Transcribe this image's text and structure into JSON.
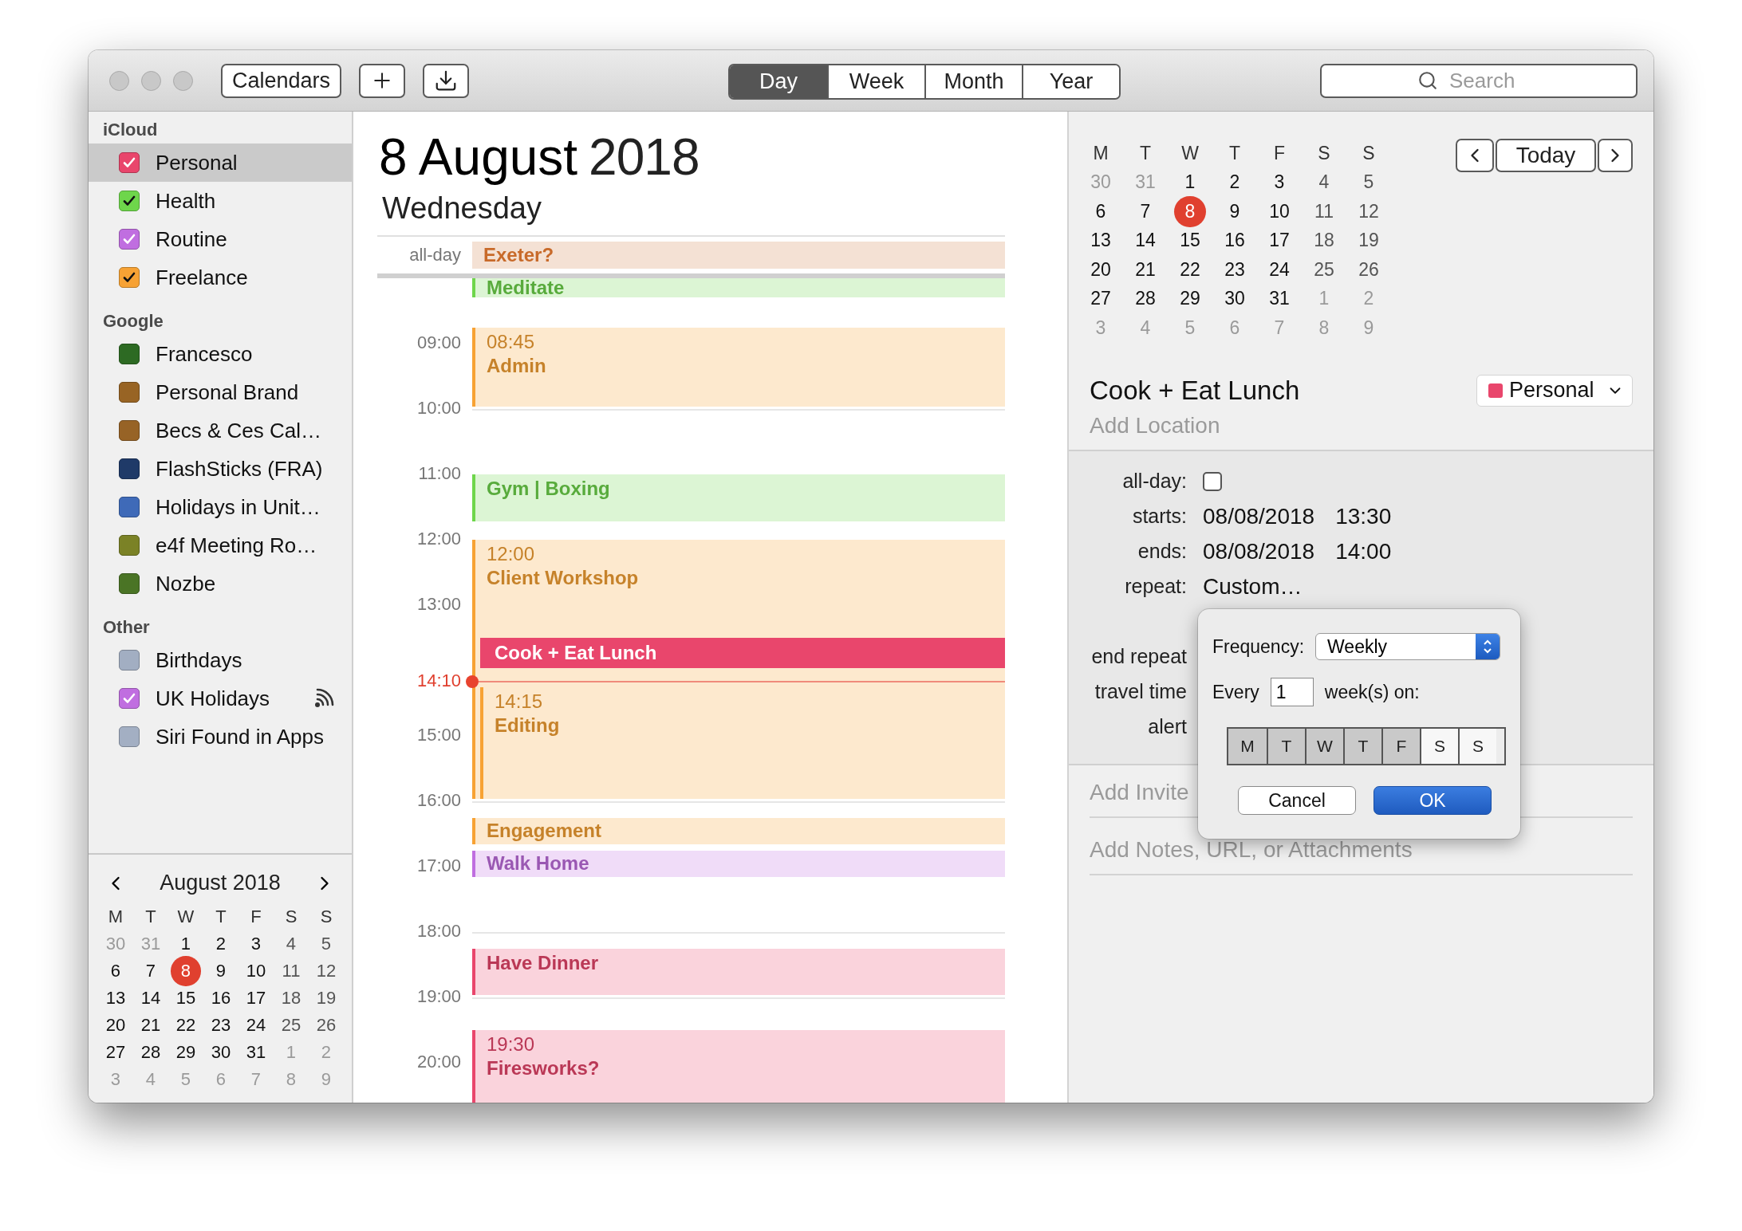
{
  "toolbar": {
    "calendars_button": "Calendars",
    "views": [
      {
        "label": "Day",
        "selected": true
      },
      {
        "label": "Week",
        "selected": false
      },
      {
        "label": "Month",
        "selected": false
      },
      {
        "label": "Year",
        "selected": false
      }
    ],
    "search": {
      "placeholder": "Search"
    }
  },
  "sidebar": {
    "groups": [
      {
        "title": "iCloud",
        "calendars": [
          {
            "name": "Personal",
            "color": "#e9466c",
            "checked": true,
            "selected": true,
            "subscribed": false
          },
          {
            "name": "Health",
            "color": "#6ed64b",
            "checked": true,
            "selected": false,
            "subscribed": false
          },
          {
            "name": "Routine",
            "color": "#c06ee0",
            "checked": true,
            "selected": false,
            "subscribed": false
          },
          {
            "name": "Freelance",
            "color": "#f7a234",
            "checked": true,
            "selected": false,
            "subscribed": false
          }
        ]
      },
      {
        "title": "Google",
        "calendars": [
          {
            "name": "Francesco",
            "color": "#2d6a23",
            "checked": false,
            "selected": false,
            "subscribed": false
          },
          {
            "name": "Personal Brand",
            "color": "#986424",
            "checked": false,
            "selected": false,
            "subscribed": false
          },
          {
            "name": "Becs & Ces Cal…",
            "color": "#976326",
            "checked": false,
            "selected": false,
            "subscribed": false
          },
          {
            "name": "FlashSticks (FRA)",
            "color": "#1f3a68",
            "checked": false,
            "selected": false,
            "subscribed": false
          },
          {
            "name": "Holidays in Unit…",
            "color": "#3f6ab8",
            "checked": false,
            "selected": false,
            "subscribed": false
          },
          {
            "name": "e4f Meeting Ro…",
            "color": "#7b8226",
            "checked": false,
            "selected": false,
            "subscribed": false
          },
          {
            "name": "Nozbe",
            "color": "#4a7425",
            "checked": false,
            "selected": false,
            "subscribed": false
          }
        ]
      },
      {
        "title": "Other",
        "calendars": [
          {
            "name": "Birthdays",
            "color": "#a2aec2",
            "checked": false,
            "selected": false,
            "subscribed": false
          },
          {
            "name": "UK Holidays",
            "color": "#c06ee0",
            "checked": true,
            "selected": false,
            "subscribed": true
          },
          {
            "name": "Siri Found in Apps",
            "color": "#a3afc3",
            "checked": false,
            "selected": false,
            "subscribed": false
          }
        ]
      }
    ],
    "mini_calendar": {
      "month": "August 2018",
      "weekdays": [
        "M",
        "T",
        "W",
        "T",
        "F",
        "S",
        "S"
      ],
      "weeks": [
        [
          {
            "d": "30",
            "outside": true,
            "today": false
          },
          {
            "d": "31",
            "outside": true,
            "today": false
          },
          {
            "d": "1",
            "outside": false,
            "today": false
          },
          {
            "d": "2",
            "outside": false,
            "today": false
          },
          {
            "d": "3",
            "outside": false,
            "today": false
          },
          {
            "d": "4",
            "outside": false,
            "today": false
          },
          {
            "d": "5",
            "outside": false,
            "today": false
          }
        ],
        [
          {
            "d": "6",
            "outside": false,
            "today": false
          },
          {
            "d": "7",
            "outside": false,
            "today": false
          },
          {
            "d": "8",
            "outside": false,
            "today": true
          },
          {
            "d": "9",
            "outside": false,
            "today": false
          },
          {
            "d": "10",
            "outside": false,
            "today": false
          },
          {
            "d": "11",
            "outside": false,
            "today": false
          },
          {
            "d": "12",
            "outside": false,
            "today": false
          }
        ],
        [
          {
            "d": "13",
            "outside": false,
            "today": false
          },
          {
            "d": "14",
            "outside": false,
            "today": false
          },
          {
            "d": "15",
            "outside": false,
            "today": false
          },
          {
            "d": "16",
            "outside": false,
            "today": false
          },
          {
            "d": "17",
            "outside": false,
            "today": false
          },
          {
            "d": "18",
            "outside": false,
            "today": false
          },
          {
            "d": "19",
            "outside": false,
            "today": false
          }
        ],
        [
          {
            "d": "20",
            "outside": false,
            "today": false
          },
          {
            "d": "21",
            "outside": false,
            "today": false
          },
          {
            "d": "22",
            "outside": false,
            "today": false
          },
          {
            "d": "23",
            "outside": false,
            "today": false
          },
          {
            "d": "24",
            "outside": false,
            "today": false
          },
          {
            "d": "25",
            "outside": false,
            "today": false
          },
          {
            "d": "26",
            "outside": false,
            "today": false
          }
        ],
        [
          {
            "d": "27",
            "outside": false,
            "today": false
          },
          {
            "d": "28",
            "outside": false,
            "today": false
          },
          {
            "d": "29",
            "outside": false,
            "today": false
          },
          {
            "d": "30",
            "outside": false,
            "today": false
          },
          {
            "d": "31",
            "outside": false,
            "today": false
          },
          {
            "d": "1",
            "outside": true,
            "today": false
          },
          {
            "d": "2",
            "outside": true,
            "today": false
          }
        ],
        [
          {
            "d": "3",
            "outside": true,
            "today": false
          },
          {
            "d": "4",
            "outside": true,
            "today": false
          },
          {
            "d": "5",
            "outside": true,
            "today": false
          },
          {
            "d": "6",
            "outside": true,
            "today": false
          },
          {
            "d": "7",
            "outside": true,
            "today": false
          },
          {
            "d": "8",
            "outside": true,
            "today": false
          },
          {
            "d": "9",
            "outside": true,
            "today": false
          }
        ]
      ]
    }
  },
  "day": {
    "date": "8 August",
    "year": "2018",
    "weekday": "Wednesday",
    "all_day_label": "all-day",
    "all_day_events": [
      {
        "title": "Exeter?",
        "color": "#c86a2a"
      }
    ],
    "hours": [
      "09:00",
      "10:00",
      "11:00",
      "12:00",
      "13:00",
      "15:00",
      "16:00",
      "17:00",
      "18:00",
      "19:00",
      "20:00"
    ],
    "now": "14:10",
    "events": [
      {
        "title": "Meditate",
        "color": "#6ed64b",
        "selected": false
      },
      {
        "time": "08:45",
        "title": "Admin",
        "color": "#f7a234",
        "selected": false
      },
      {
        "title": "Gym | Boxing",
        "color": "#6ed64b",
        "selected": false
      },
      {
        "time": "12:00",
        "title": "Client Workshop",
        "color": "#f7a234",
        "selected": false
      },
      {
        "title": "Cook + Eat Lunch",
        "color": "#e9466c",
        "selected": true
      },
      {
        "time": "14:15",
        "title": "Editing",
        "color": "#f7a234",
        "selected": false
      },
      {
        "title": "Engagement",
        "color": "#f7a234",
        "selected": false
      },
      {
        "title": "Walk Home",
        "color": "#c06ee0",
        "selected": false
      },
      {
        "title": "Have Dinner",
        "color": "#e9466c",
        "selected": false
      },
      {
        "time": "19:30",
        "title": "Firesworks?",
        "color": "#e9466c",
        "selected": false
      }
    ]
  },
  "inspector": {
    "today_button": "Today",
    "mini_calendar": {
      "weekdays": [
        "M",
        "T",
        "W",
        "T",
        "F",
        "S",
        "S"
      ],
      "weeks": [
        [
          {
            "d": "30",
            "outside": true,
            "today": false
          },
          {
            "d": "31",
            "outside": true,
            "today": false
          },
          {
            "d": "1",
            "outside": false,
            "today": false
          },
          {
            "d": "2",
            "outside": false,
            "today": false
          },
          {
            "d": "3",
            "outside": false,
            "today": false
          },
          {
            "d": "4",
            "outside": false,
            "today": false
          },
          {
            "d": "5",
            "outside": false,
            "today": false
          }
        ],
        [
          {
            "d": "6",
            "outside": false,
            "today": false
          },
          {
            "d": "7",
            "outside": false,
            "today": false
          },
          {
            "d": "8",
            "outside": false,
            "today": true
          },
          {
            "d": "9",
            "outside": false,
            "today": false
          },
          {
            "d": "10",
            "outside": false,
            "today": false
          },
          {
            "d": "11",
            "outside": false,
            "today": false
          },
          {
            "d": "12",
            "outside": false,
            "today": false
          }
        ],
        [
          {
            "d": "13",
            "outside": false,
            "today": false
          },
          {
            "d": "14",
            "outside": false,
            "today": false
          },
          {
            "d": "15",
            "outside": false,
            "today": false
          },
          {
            "d": "16",
            "outside": false,
            "today": false
          },
          {
            "d": "17",
            "outside": false,
            "today": false
          },
          {
            "d": "18",
            "outside": false,
            "today": false
          },
          {
            "d": "19",
            "outside": false,
            "today": false
          }
        ],
        [
          {
            "d": "20",
            "outside": false,
            "today": false
          },
          {
            "d": "21",
            "outside": false,
            "today": false
          },
          {
            "d": "22",
            "outside": false,
            "today": false
          },
          {
            "d": "23",
            "outside": false,
            "today": false
          },
          {
            "d": "24",
            "outside": false,
            "today": false
          },
          {
            "d": "25",
            "outside": false,
            "today": false
          },
          {
            "d": "26",
            "outside": false,
            "today": false
          }
        ],
        [
          {
            "d": "27",
            "outside": false,
            "today": false
          },
          {
            "d": "28",
            "outside": false,
            "today": false
          },
          {
            "d": "29",
            "outside": false,
            "today": false
          },
          {
            "d": "30",
            "outside": false,
            "today": false
          },
          {
            "d": "31",
            "outside": false,
            "today": false
          },
          {
            "d": "1",
            "outside": true,
            "today": false
          },
          {
            "d": "2",
            "outside": true,
            "today": false
          }
        ],
        [
          {
            "d": "3",
            "outside": true,
            "today": false
          },
          {
            "d": "4",
            "outside": true,
            "today": false
          },
          {
            "d": "5",
            "outside": true,
            "today": false
          },
          {
            "d": "6",
            "outside": true,
            "today": false
          },
          {
            "d": "7",
            "outside": true,
            "today": false
          },
          {
            "d": "8",
            "outside": true,
            "today": false
          },
          {
            "d": "9",
            "outside": true,
            "today": false
          }
        ]
      ]
    },
    "event": {
      "title": "Cook + Eat Lunch",
      "calendar": {
        "name": "Personal",
        "color": "#e9466c"
      },
      "location": {
        "placeholder": "Add Location"
      },
      "fields": [
        {
          "label": "all-day:",
          "kind": "checkbox",
          "checked": false
        },
        {
          "label": "starts:",
          "kind": "datetime",
          "date": "08/08/2018",
          "time": "13:30"
        },
        {
          "label": "ends:",
          "kind": "datetime",
          "date": "08/08/2018",
          "time": "14:00"
        },
        {
          "label": "repeat:",
          "kind": "text",
          "value": "Custom…"
        },
        {
          "label": "end repeat",
          "kind": "covered"
        },
        {
          "label": "travel time",
          "kind": "covered"
        },
        {
          "label": "alert",
          "kind": "covered"
        }
      ],
      "invitees": {
        "placeholder": "Add Invite"
      },
      "notes": {
        "placeholder": "Add Notes, URL, or Attachments"
      }
    },
    "repeat_popup": {
      "frequency_label": "Frequency:",
      "frequency": "Weekly",
      "every_label": "Every",
      "interval": "1",
      "unit_label": "week(s) on:",
      "days": [
        {
          "label": "M",
          "selected": true
        },
        {
          "label": "T",
          "selected": true
        },
        {
          "label": "W",
          "selected": true
        },
        {
          "label": "T",
          "selected": true
        },
        {
          "label": "F",
          "selected": true
        },
        {
          "label": "S",
          "selected": false
        },
        {
          "label": "S",
          "selected": false
        }
      ],
      "cancel": "Cancel",
      "ok": "OK"
    }
  }
}
